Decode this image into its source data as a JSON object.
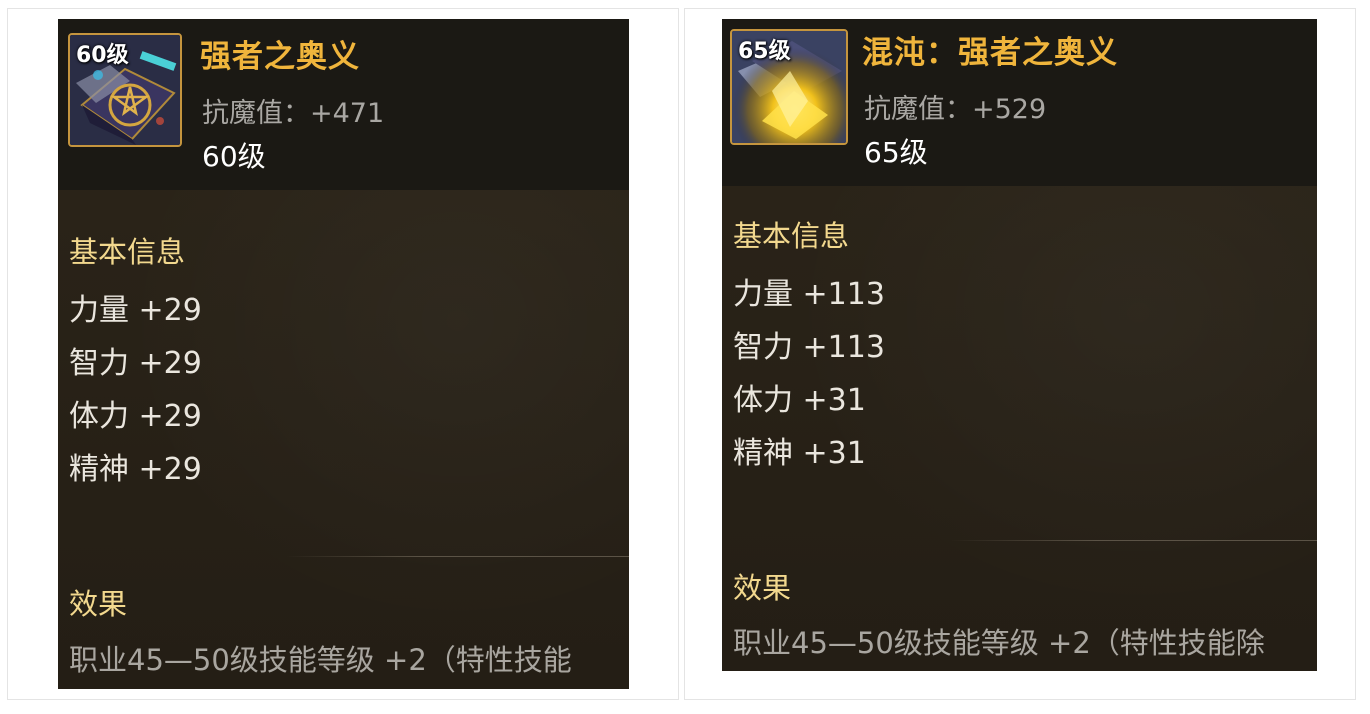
{
  "cards": [
    {
      "level_badge": "60级",
      "name": "强者之奥义",
      "magic_resist": "抗魔值：+471",
      "level": "60级",
      "basic_info_title": "基本信息",
      "stats": [
        "力量 +29",
        "智力 +29",
        "体力 +29",
        "精神 +29"
      ],
      "effect_title": "效果",
      "effect_text": "职业45—50级技能等级 +2（特性技能"
    },
    {
      "level_badge": "65级",
      "name": "混沌：强者之奥义",
      "magic_resist": "抗魔值：+529",
      "level": "65级",
      "basic_info_title": "基本信息",
      "stats": [
        "力量 +113",
        "智力 +113",
        "体力 +31",
        "精神 +31"
      ],
      "effect_title": "效果",
      "effect_text": "职业45—50级技能等级 +2（特性技能除"
    }
  ],
  "colors": {
    "name": "#f0b53c",
    "section_title": "#f2d88e",
    "header_bg": "#1b1914",
    "body_bg": "#272118",
    "icon_border": "#c5953e"
  },
  "icons": [
    "pentagram-book-icon",
    "glowing-chaos-book-icon"
  ]
}
